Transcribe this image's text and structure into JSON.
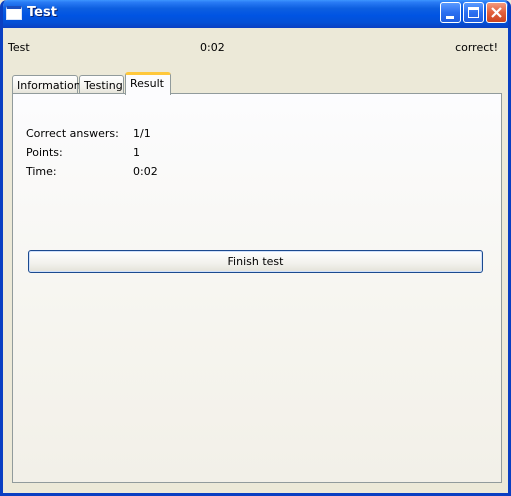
{
  "window": {
    "title": "Test"
  },
  "status": {
    "test_name": "Test",
    "timer": "0:02",
    "result_message": "correct!"
  },
  "tabs": [
    {
      "label": "Information",
      "active": false
    },
    {
      "label": "Testing",
      "active": false
    },
    {
      "label": "Result",
      "active": true
    }
  ],
  "result": {
    "rows": [
      {
        "label": "Correct answers:",
        "value": "1/1"
      },
      {
        "label": "Points:",
        "value": "1"
      },
      {
        "label": "Time:",
        "value": "0:02"
      }
    ],
    "finish_button_label": "Finish test"
  },
  "colors": {
    "titlebar": "#0054e3",
    "window_bg": "#ece9d8",
    "active_tab_accent": "#ffc83c",
    "close_button": "#e2603b"
  },
  "icons": {
    "window": "window-icon",
    "minimize": "minimize-icon",
    "maximize": "maximize-icon",
    "close": "close-icon"
  }
}
